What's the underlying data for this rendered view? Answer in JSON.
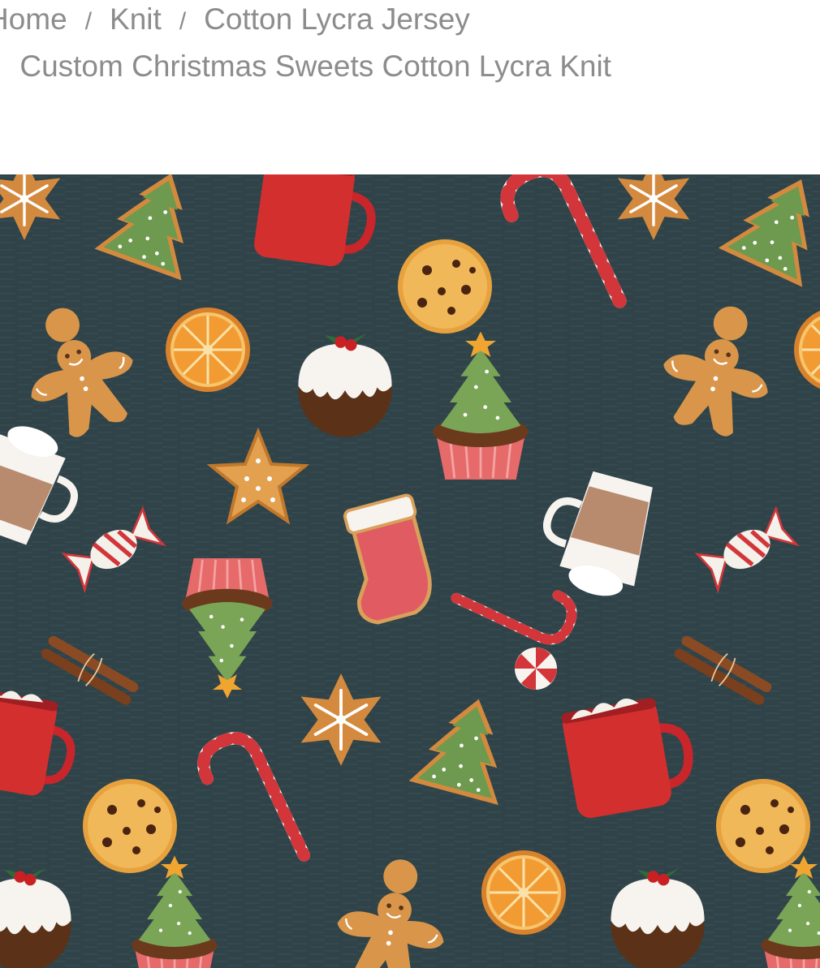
{
  "breadcrumb": {
    "items": [
      {
        "label": "Home"
      },
      {
        "label": "Knit"
      },
      {
        "label": "Cotton Lycra Jersey"
      }
    ],
    "separator": "/",
    "current": "Custom Christmas Sweets Cotton Lycra Knit"
  },
  "product_image": {
    "background": "#2f4349"
  }
}
